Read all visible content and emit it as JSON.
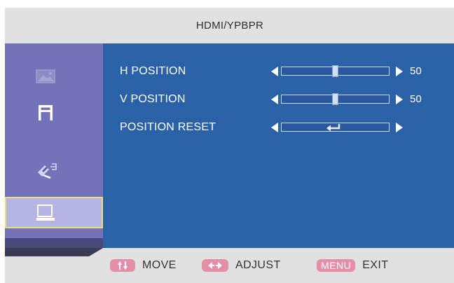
{
  "header": {
    "title": "HDMI/YPBPR"
  },
  "sidebar": {
    "items": [
      {
        "icon": "picture-icon",
        "active": false
      },
      {
        "icon": "audio-icon",
        "active": false
      },
      {
        "icon": "settings-tool-icon",
        "active": false
      },
      {
        "icon": "monitor-icon",
        "active": true
      }
    ]
  },
  "rows": [
    {
      "label": "H POSITION",
      "value": "50",
      "level": 0.5
    },
    {
      "label": "V POSITION",
      "value": "50",
      "level": 0.5
    },
    {
      "label": "POSITION RESET",
      "control": "enter-icon"
    }
  ],
  "footer": {
    "move_label": "MOVE",
    "adjust_label": "ADJUST",
    "menu_badge": "MENU",
    "exit_label": "EXIT"
  },
  "colors": {
    "content_bg": "#2b62a7",
    "sidebar_bg": "#7473b9",
    "badge": "#e48fa6",
    "header_bg": "#e1e1e1"
  }
}
